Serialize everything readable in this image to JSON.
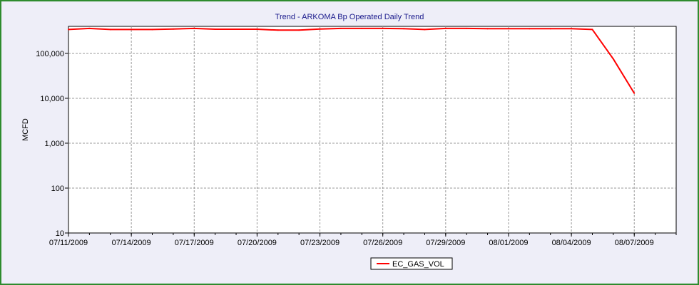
{
  "chart_data": {
    "type": "line",
    "title": "Trend - ARKOMA  Bp Operated Daily Trend",
    "ylabel": "MCFD",
    "xlabel": "",
    "yscale": "log",
    "ylim": [
      10,
      400000
    ],
    "y_ticks": [
      10,
      100,
      1000,
      10000,
      100000
    ],
    "y_tick_labels": [
      "10",
      "100",
      "1,000",
      "10,000",
      "100,000"
    ],
    "x_ticks": [
      "07/11/2009",
      "07/14/2009",
      "07/17/2009",
      "07/20/2009",
      "07/23/2009",
      "07/26/2009",
      "07/29/2009",
      "08/01/2009",
      "08/04/2009",
      "08/07/2009"
    ],
    "xlim": [
      "07/11/2009",
      "08/09/2009"
    ],
    "grid": true,
    "legend_position": "bottom-center",
    "series": [
      {
        "name": "EC_GAS_VOL",
        "color": "#ff0000",
        "x": [
          "07/11/2009",
          "07/12/2009",
          "07/13/2009",
          "07/14/2009",
          "07/15/2009",
          "07/16/2009",
          "07/17/2009",
          "07/18/2009",
          "07/19/2009",
          "07/20/2009",
          "07/21/2009",
          "07/22/2009",
          "07/23/2009",
          "07/24/2009",
          "07/25/2009",
          "07/26/2009",
          "07/27/2009",
          "07/28/2009",
          "07/29/2009",
          "07/30/2009",
          "07/31/2009",
          "08/01/2009",
          "08/02/2009",
          "08/03/2009",
          "08/04/2009",
          "08/05/2009",
          "08/06/2009",
          "08/07/2009"
        ],
        "values": [
          340000,
          360000,
          340000,
          340000,
          340000,
          350000,
          360000,
          345000,
          345000,
          345000,
          330000,
          330000,
          350000,
          360000,
          360000,
          360000,
          355000,
          340000,
          360000,
          360000,
          355000,
          355000,
          355000,
          355000,
          355000,
          340000,
          75000,
          13000
        ]
      }
    ]
  }
}
